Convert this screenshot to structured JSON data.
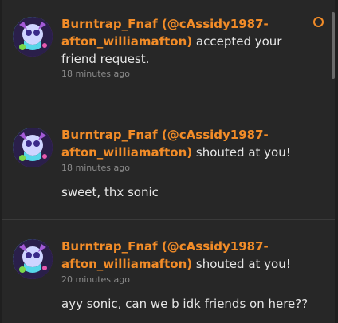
{
  "notifications": [
    {
      "user": "Burntrap_Fnaf (@cAssidy1987-afton_williamafton)",
      "action": " accepted your friend request.",
      "time": "18 minutes ago",
      "message": ""
    },
    {
      "user": "Burntrap_Fnaf (@cAssidy1987-afton_williamafton)",
      "action": " shouted at you!",
      "time": "18 minutes ago",
      "message": "sweet, thx sonic"
    },
    {
      "user": "Burntrap_Fnaf (@cAssidy1987-afton_williamafton)",
      "action": " shouted at you!",
      "time": "20 minutes ago",
      "message": "ayy sonic, can we b idk friends on here??"
    }
  ],
  "colors": {
    "accent": "#f28c28",
    "panel": "#272727",
    "text": "#e6e6e6",
    "muted": "#8a8a8a"
  }
}
